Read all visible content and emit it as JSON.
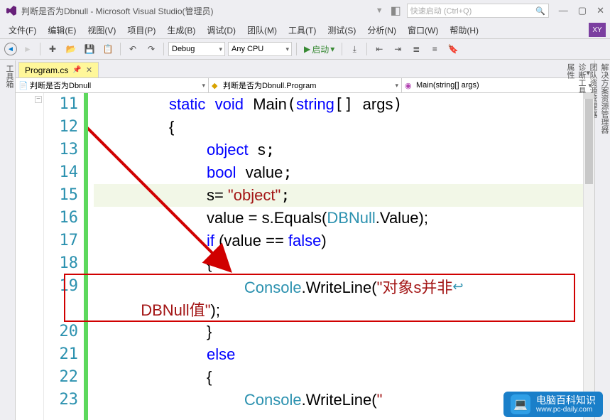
{
  "window": {
    "title": "判断是否为Dbnull - Microsoft Visual Studio(管理员)",
    "quick_launch_placeholder": "快速启动 (Ctrl+Q)",
    "user_badge": "XY"
  },
  "menus": {
    "file": "文件(F)",
    "edit": "编辑(E)",
    "view": "视图(V)",
    "project": "项目(P)",
    "build": "生成(B)",
    "debug": "调试(D)",
    "team": "团队(M)",
    "tools": "工具(T)",
    "test": "测试(S)",
    "analyze": "分析(N)",
    "window": "窗口(W)",
    "help": "帮助(H)"
  },
  "toolbar": {
    "config": "Debug",
    "platform": "Any CPU",
    "start_label": "启动"
  },
  "side_tools": {
    "left": "工具箱",
    "right": [
      "解决方案资源管理器",
      "团队资源管理器",
      "诊断工具",
      "属性"
    ]
  },
  "tabs": {
    "file_name": "Program.cs"
  },
  "nav": {
    "project": "判断是否为Dbnull",
    "class": "判断是否为Dbnull.Program",
    "method": "Main(string[] args)"
  },
  "code": {
    "lines": [
      {
        "n": "11"
      },
      {
        "n": "12"
      },
      {
        "n": "13"
      },
      {
        "n": "14"
      },
      {
        "n": "15"
      },
      {
        "n": "16"
      },
      {
        "n": "17"
      },
      {
        "n": "18"
      },
      {
        "n": "19"
      },
      {
        "n": ""
      },
      {
        "n": "20"
      },
      {
        "n": "21"
      },
      {
        "n": "22"
      },
      {
        "n": "23"
      }
    ],
    "tokens": {
      "static": "static",
      "void": "void",
      "main": "Main",
      "string": "string",
      "args": "args",
      "object": "object",
      "s": "s",
      "bool": "bool",
      "value": "value",
      "s_assign": "s= ",
      "object_str": "\"object\"",
      "value_assign": "value = s.Equals(",
      "dbnull": "DBNull",
      "dotvalue": ".Value);",
      "if": "if",
      "if_cond_open": " (value == ",
      "false": "false",
      "if_cond_close": ")",
      "console": "Console",
      "writeline": ".WriteLine(",
      "msg1": "\"对象s并非",
      "msg1b": "DBNull值\"",
      "close_paren": ");",
      "else": "else",
      "writeline2_open": ".WriteLine(",
      "brace_open": "{",
      "brace_close": "}"
    }
  },
  "watermark": {
    "title": "电脑百科知识",
    "url": "www.pc-daily.com"
  }
}
